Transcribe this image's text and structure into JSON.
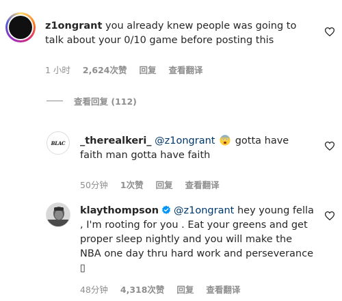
{
  "comments": [
    {
      "username": "z1ongrant",
      "text": "you already knew people was going to talk about your 0/10 game before posting this",
      "time": "1 小时",
      "likes": "2,624次赞",
      "reply_label": "回复",
      "translate_label": "查看翻译"
    }
  ],
  "view_replies": "查看回复 (112)",
  "replies": [
    {
      "username": "_therealkeri_",
      "mention": "@z1ongrant",
      "text": "gotta have faith man gotta have faith",
      "time": "50分钟",
      "likes": "1次赞",
      "reply_label": "回复",
      "translate_label": "查看翻译",
      "avatar_text": "BLAC"
    },
    {
      "username": "klaythompson",
      "mention": "@z1ongrant",
      "text": "hey young fella , I'm rooting for you . Eat your greens and get proper sleep nightly and you will make the NBA one day thru hard work and perseverance",
      "trailing_glyph": "▯",
      "time": "48分钟",
      "likes": "4,318次赞",
      "reply_label": "回复",
      "translate_label": "查看翻译"
    }
  ],
  "colors": {
    "text": "#262626",
    "secondary": "#8e8e8e",
    "mention": "#00376b",
    "verified": "#0095f6"
  },
  "icons": [
    "heart-outline-icon",
    "verified-badge-icon",
    "fearful-face-emoji"
  ]
}
